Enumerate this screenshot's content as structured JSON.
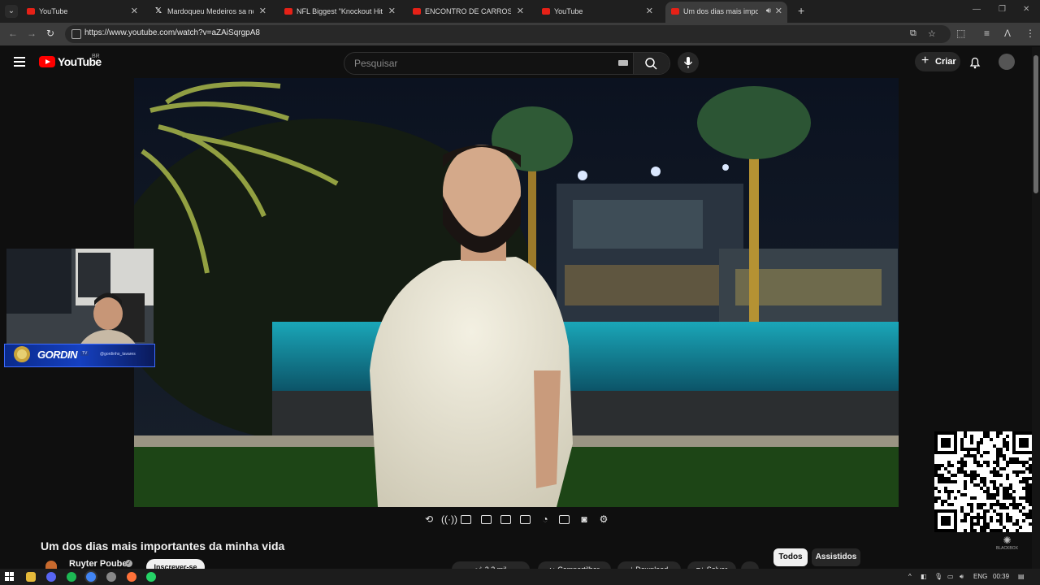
{
  "browser": {
    "tabs": [
      {
        "title": "YouTube",
        "favicon": "youtube-icon",
        "active": false,
        "audio": false
      },
      {
        "title": "Mardoqueu Medeiros sa no X:",
        "favicon": "x-logo-icon",
        "active": false,
        "audio": false
      },
      {
        "title": "NFL Biggest \"Knockout Hits\" - Y",
        "favicon": "youtube-icon",
        "active": false,
        "audio": false
      },
      {
        "title": "ENCONTRO DE CARROS NO EL",
        "favicon": "youtube-icon",
        "active": false,
        "audio": false
      },
      {
        "title": "YouTube",
        "favicon": "youtube-icon",
        "active": false,
        "audio": false
      },
      {
        "title": "Um dos dias mais importan",
        "favicon": "youtube-icon",
        "active": true,
        "audio": true
      }
    ],
    "url": "https://www.youtube.com/watch?v=aZAiSqrgpA8"
  },
  "youtube": {
    "logo_text": "YouTube",
    "country_code": "BR",
    "search_placeholder": "Pesquisar",
    "create_label": "Criar"
  },
  "video": {
    "title": "Um dos dias mais importantes da minha vida",
    "channel": "Ruyter Poubel",
    "subscribe_label": "Inscrever-se",
    "likes": "2,2 mil",
    "share_label": "Compartilhar",
    "download_label": "Download",
    "save_label": "Salvar"
  },
  "webcam_overlay": {
    "name": "GORDIN",
    "badge": "TV",
    "handle": "@gordinho_tavares"
  },
  "related_chips": {
    "items": [
      "Todos",
      "Assistidos"
    ],
    "selected": "Todos"
  },
  "watermark": "BLACKBOX",
  "taskbar": {
    "language": "ENG",
    "clock": "00:39"
  },
  "colors": {
    "youtube_red": "#ff0000",
    "background": "#0f0f0f",
    "chip_selected": "#f1f1f1",
    "overlay_blue": "#1540c0"
  }
}
